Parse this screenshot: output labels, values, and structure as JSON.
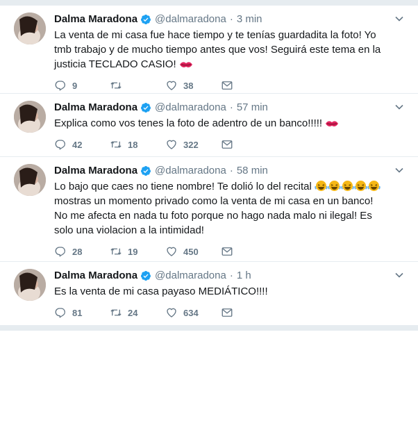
{
  "colors": {
    "accent": "#1da1f2",
    "icon": "#657786",
    "kiss": "#e0245e",
    "laugh": "#f5b716"
  },
  "tweets": [
    {
      "name": "Dalma Maradona",
      "handle": "@dalmaradona",
      "sep": "·",
      "time": "3 min",
      "text": "La venta de mi casa fue hace tiempo y te tenías guardadita la foto! Yo tmb trabajo y de mucho tiempo antes que vos! Seguirá este tema en la justicia TECLADO CASIO! ",
      "emoji": "kiss-emoji",
      "replies": "9",
      "retweets": "",
      "likes": "38"
    },
    {
      "name": "Dalma Maradona",
      "handle": "@dalmaradona",
      "sep": "·",
      "time": "57 min",
      "text": "Explica como vos tenes la foto de adentro de un banco!!!!! ",
      "emoji": "kiss-emoji",
      "replies": "42",
      "retweets": "18",
      "likes": "322"
    },
    {
      "name": "Dalma Maradona",
      "handle": "@dalmaradona",
      "sep": "·",
      "time": "58 min",
      "text_before": "Lo bajo que caes no tiene nombre! Te dolió lo del recital ",
      "text_after": " mostras un momento privado como la venta de mi casa en un banco! No me afecta en nada tu foto porque no hago nada malo ni ilegal! Es solo una  violacion a la intimidad!",
      "emoji": "laughing-emoji",
      "replies": "28",
      "retweets": "19",
      "likes": "450"
    },
    {
      "name": "Dalma Maradona",
      "handle": "@dalmaradona",
      "sep": "·",
      "time": "1 h",
      "text": "Es la venta de mi casa payaso MEDIÁTICO!!!!",
      "replies": "81",
      "retweets": "24",
      "likes": "634"
    }
  ]
}
